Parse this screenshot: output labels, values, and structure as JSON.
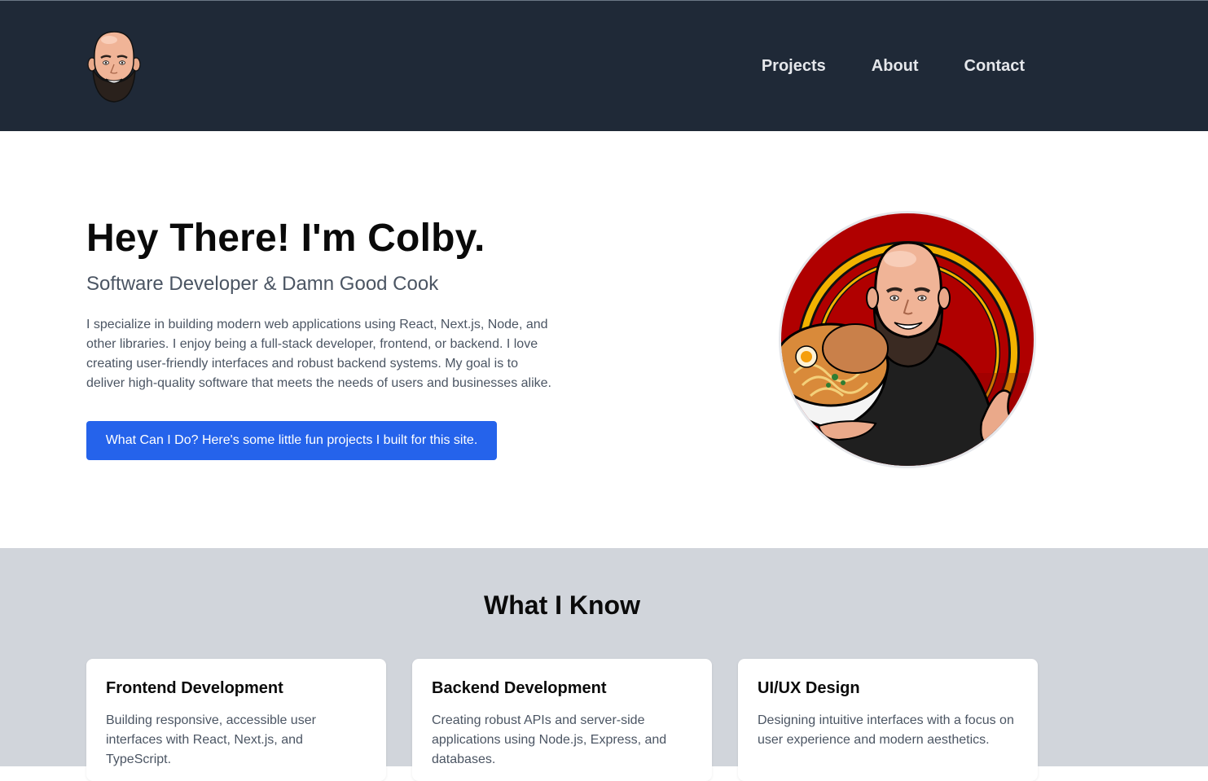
{
  "header": {
    "logo_icon": "cartoon-face-avatar-icon",
    "nav": [
      {
        "label": "Projects"
      },
      {
        "label": "About"
      },
      {
        "label": "Contact"
      }
    ],
    "background": "#1f2937"
  },
  "hero": {
    "title": "Hey There! I'm Colby.",
    "subtitle": "Software Developer & Damn Good Cook",
    "body": "I specialize in building modern web applications using React, Next.js, Node, and other libraries. I enjoy being a full-stack developer, frontend, or backend. I love creating user-friendly interfaces and robust backend systems. My goal is to deliver high-quality software that meets the needs of users and businesses alike.",
    "cta_label": "What Can I Do? Here's some little fun projects I built for this site.",
    "cta_color": "#2563eb",
    "portrait_icon": "chef-portrait-with-ramen-icon"
  },
  "skills": {
    "title": "What I Know",
    "background": "#d1d5db",
    "cards": [
      {
        "title": "Frontend Development",
        "text": "Building responsive, accessible user interfaces with React, Next.js, and TypeScript."
      },
      {
        "title": "Backend Development",
        "text": "Creating robust APIs and server-side applications using Node.js, Express, and databases."
      },
      {
        "title": "UI/UX Design",
        "text": "Designing intuitive interfaces with a focus on user experience and modern aesthetics."
      }
    ]
  }
}
